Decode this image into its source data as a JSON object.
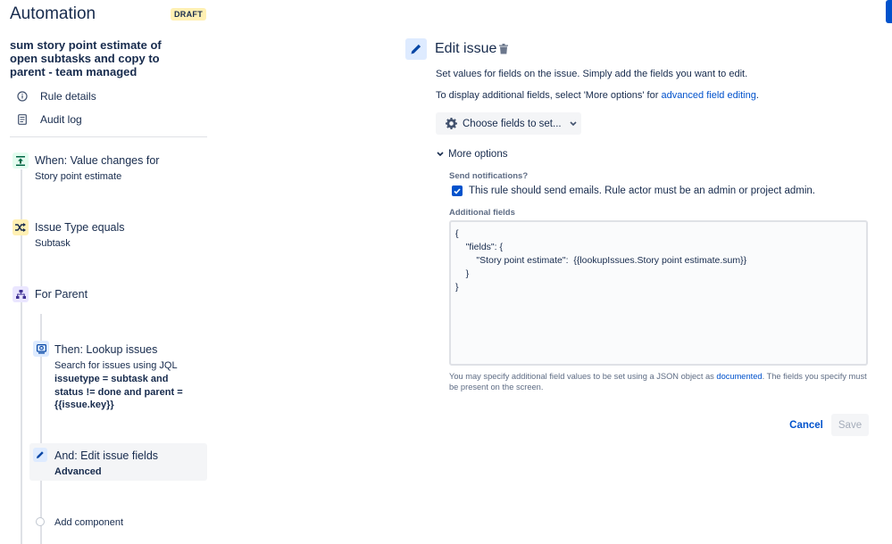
{
  "app": {
    "title": "Automation",
    "status_badge": "DRAFT"
  },
  "rule": {
    "name": "sum story point estimate of open subtasks and copy to parent - team managed"
  },
  "sidebar": {
    "nav": [
      {
        "label": "Rule details",
        "icon": "info-icon"
      },
      {
        "label": "Audit log",
        "icon": "document-icon"
      }
    ],
    "steps": [
      {
        "title": "When: Value changes for",
        "sub": "Story point estimate",
        "icon": "trigger-icon",
        "color": "#e3fcef"
      },
      {
        "title": "Issue Type equals",
        "sub": "Subtask",
        "icon": "shuffle-icon",
        "color": "#fff0b3"
      },
      {
        "title": "For Parent",
        "icon": "hierarchy-icon",
        "color": "#eae6ff"
      },
      {
        "title": "Then: Lookup issues",
        "sub": "Search for issues using JQL",
        "sub_bold": "issuetype = subtask and status != done and parent = {{issue.key}}",
        "icon": "lookup-icon",
        "color": "#deebff"
      },
      {
        "title": "And: Edit issue fields",
        "sub_bold": "Advanced",
        "icon": "pencil-icon",
        "color": "#deebff"
      }
    ],
    "add_component": "Add component"
  },
  "main": {
    "title": "Edit issue",
    "desc1": "Set values for fields on the issue. Simply add the fields you want to edit.",
    "desc2_prefix": "To display additional fields, select 'More options' for ",
    "desc2_link": "advanced field editing",
    "desc2_suffix": ".",
    "choose_fields": "Choose fields to set...",
    "more_options": "More options",
    "send_notifications_label": "Send notifications?",
    "send_notifications_text": "This rule should send emails. Rule actor must be an admin or project admin.",
    "send_notifications_checked": true,
    "additional_fields_label": "Additional fields",
    "additional_fields_value": "{\n    \"fields\": {\n        \"Story point estimate\":  {{lookupIssues.Story point estimate.sum}}\n    }\n}",
    "help_prefix": "You may specify additional field values to be set using a JSON object as ",
    "help_link": "documented",
    "help_suffix": ". The fields you specify must be present on the screen.",
    "cancel": "Cancel",
    "save": "Save"
  }
}
